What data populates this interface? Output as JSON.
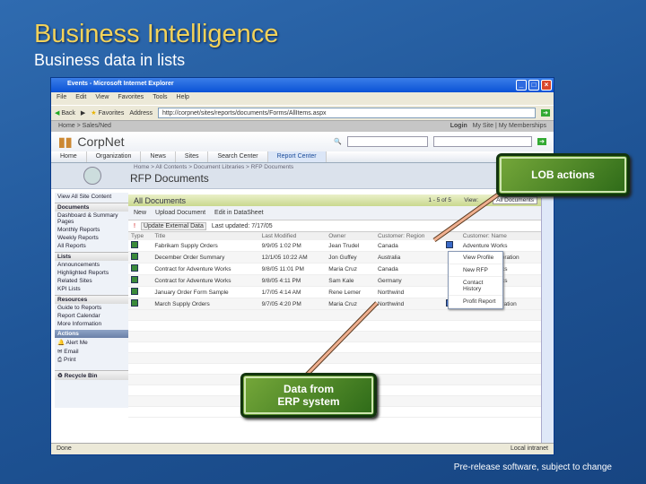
{
  "slide": {
    "title": "Business Intelligence",
    "subtitle": "Business data in lists",
    "footer": "Pre-release software, subject to change"
  },
  "browser": {
    "title": "Events - Microsoft Internet Explorer",
    "menu": [
      "File",
      "Edit",
      "View",
      "Favorites",
      "Tools",
      "Help"
    ],
    "back": "Back",
    "favorites": "Favorites",
    "address_label": "Address",
    "address": "http://corpnet/sites/reports/documents/Forms/AllItems.aspx",
    "go": "Go",
    "status": "Done",
    "zone": "Local intranet"
  },
  "sharepoint": {
    "top_breadcrumb": "Home > Sales/Ned",
    "login": "Login",
    "top_links": "My Site | My Memberships",
    "logo": "CorpNet",
    "tabs": [
      "Home",
      "Organization",
      "News",
      "Sites",
      "Search Center",
      "Report Center"
    ],
    "selected_tab": "Report Center",
    "breadcrumb": "Home > All Contents > Document Libraries > RFP Documents",
    "page_title": "RFP Documents"
  },
  "leftnav": {
    "view_all": "View All Site Content",
    "documents_header": "Documents",
    "documents": [
      "Dashboard & Summary Pages",
      "Monthly Reports",
      "Weekly Reports",
      "All Reports"
    ],
    "lists_header": "Lists",
    "lists": [
      "Announcements",
      "Highlighted Reports",
      "Related Sites",
      "KPI Lists"
    ],
    "resources_header": "Resources",
    "resources": [
      "Guide to Reports",
      "Report Calendar",
      "More Information"
    ],
    "actions_header": "Actions",
    "actions": [
      "Alert Me",
      "Email",
      "Print"
    ],
    "recycle": "Recycle Bin"
  },
  "list": {
    "title": "All Documents",
    "paging": "1 - 5 of 5",
    "view_label": "View:",
    "view_value": "All Documents",
    "toolbar": [
      "New",
      "Upload Document",
      "Edit in DataSheet"
    ],
    "filter_label": "Update External Data",
    "filter_value": "Last updated: 7/17/05",
    "columns": [
      "Type",
      "Title",
      "Last Modified",
      "Owner",
      "Customer: Region",
      "",
      "Customer: Name"
    ],
    "rows": [
      [
        "Fabrikam Supply Orders",
        "9/9/05 1:02 PM",
        "Jean Trudel",
        "Canada",
        "Adventure Works"
      ],
      [
        "December Order Summary",
        "12/1/05 10:22 AM",
        "Jon Guffey",
        "Australia",
        "A. Datum Corporation"
      ],
      [
        "Contract for Adventure Works",
        "9/8/05 11:01 PM",
        "Maria Cruz",
        "Canada",
        "Adventure Works"
      ],
      [
        "Contract for Adventure Works",
        "9/8/05 4:11 PM",
        "Sam Kale",
        "Germany",
        "Adventure Works"
      ],
      [
        "January Order Form Sample",
        "1/7/05 4:14 AM",
        "Rene Lemer",
        "Northwind",
        "Proseware, Inc."
      ],
      [
        "March Supply Orders",
        "9/7/05 4:20 PM",
        "Maria Cruz",
        "Northwind",
        "Contoso Corporation"
      ]
    ],
    "context_menu": [
      "View Profile",
      "New RFP",
      "Contact History",
      "Profit Report"
    ]
  },
  "callouts": {
    "lob": "LOB actions",
    "erp_line1": "Data from",
    "erp_line2": "ERP system"
  }
}
